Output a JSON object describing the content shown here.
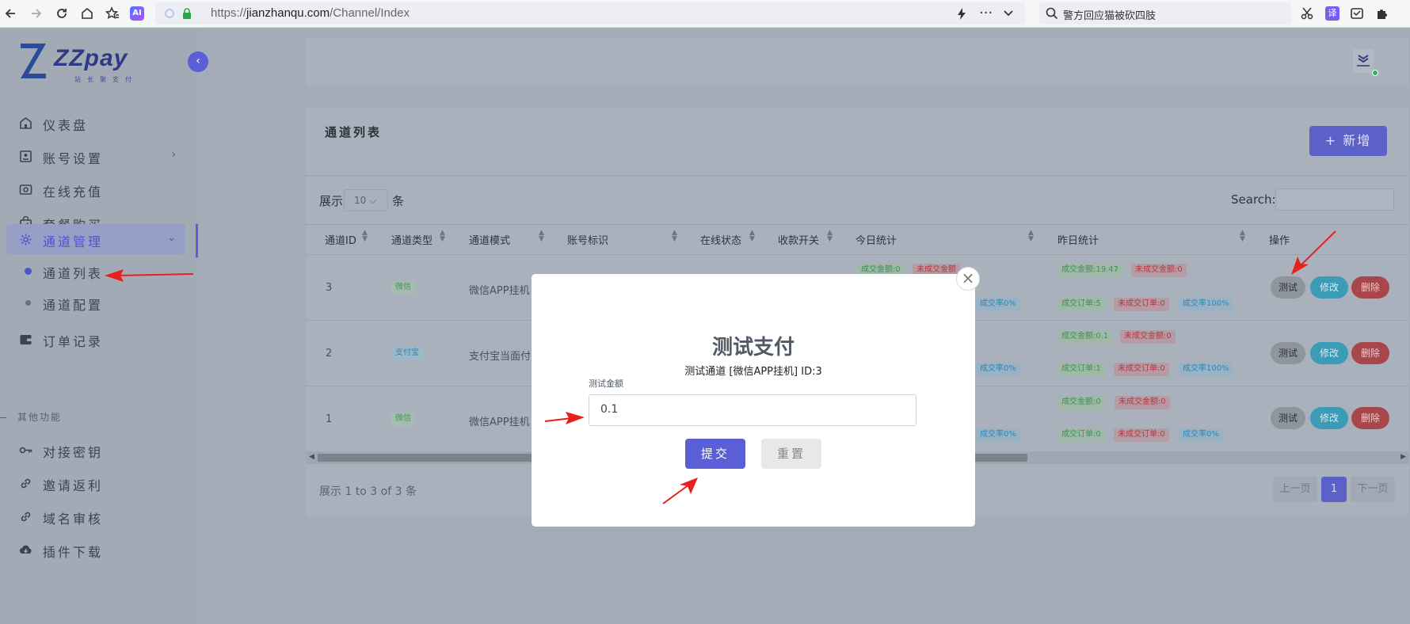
{
  "browser": {
    "url_prefix": "https://",
    "url_host": "jianzhanqu.com",
    "url_path": "/Channel/Index",
    "search_query": "警方回应猫被砍四肢",
    "ai_badge": "AI"
  },
  "sidebar": {
    "logo_word": "ZZpay",
    "logo_sub": "站长聚支付",
    "items": [
      {
        "label": "仪表盘",
        "icon": "home-icon"
      },
      {
        "label": "账号设置",
        "icon": "id-card-icon"
      },
      {
        "label": "在线充值",
        "icon": "camera-icon"
      },
      {
        "label": "套餐购买",
        "icon": "bag-icon"
      },
      {
        "label": "通道管理",
        "icon": "gear-icon"
      }
    ],
    "subitems": [
      {
        "label": "通道列表"
      },
      {
        "label": "通道配置"
      }
    ],
    "order_item": {
      "label": "订单记录",
      "icon": "wallet-icon"
    },
    "section_label": "其他功能",
    "other_items": [
      {
        "label": "对接密钥",
        "icon": "key-icon"
      },
      {
        "label": "邀请返利",
        "icon": "link-icon"
      },
      {
        "label": "域名审核",
        "icon": "link-icon"
      },
      {
        "label": "插件下载",
        "icon": "cloud-download-icon"
      }
    ]
  },
  "card": {
    "title": "通道列表",
    "add_label": "+ 新增",
    "length_prefix": "展示",
    "length_value": "10",
    "length_suffix": "条",
    "search_label": "Search:",
    "info": "展示 1 to 3 of 3 条",
    "pagination": {
      "prev": "上一页",
      "current": "1",
      "next": "下一页"
    }
  },
  "table": {
    "headers": [
      "通道ID",
      "通道类型",
      "通道模式",
      "账号标识",
      "在线状态",
      "收款开关",
      "今日统计",
      "昨日统计",
      "操作"
    ],
    "rows": [
      {
        "id": "3",
        "type": "微信",
        "mode": "微信APP挂机",
        "today": {
          "success_amount": "成交金额:0",
          "fail_amount": "未成交金额",
          "rate": "成交率0%"
        },
        "yesterday": {
          "success_amount": "成交金额:19.47",
          "fail_amount": "未成交金额:0",
          "success_orders": "成交订单:5",
          "fail_orders": "未成交订单:0",
          "rate": "成交率100%"
        }
      },
      {
        "id": "2",
        "type": "支付宝",
        "mode": "支付宝当面付",
        "today": {
          "rate": "成交率0%"
        },
        "yesterday": {
          "success_amount": "成交金额:0.1",
          "fail_amount": "未成交金额:0",
          "success_orders": "成交订单:1",
          "fail_orders": "未成交订单:0",
          "rate": "成交率100%"
        }
      },
      {
        "id": "1",
        "type": "微信",
        "mode": "微信APP挂机",
        "today": {
          "rate": "成交率0%"
        },
        "yesterday": {
          "success_amount": "成交金额:0",
          "fail_amount": "未成交金额:0",
          "success_orders": "成交订单:0",
          "fail_orders": "未成交订单:0",
          "rate": "成交率0%"
        }
      }
    ],
    "actions": {
      "test": "测试",
      "edit": "修改",
      "delete": "删除"
    }
  },
  "modal": {
    "title": "测试支付",
    "subtitle": "测试通道 [微信APP挂机] ID:3",
    "amount_label": "测试金额",
    "amount_value": "0.1",
    "submit": "提交",
    "reset": "重置",
    "close": "×"
  },
  "colors": {
    "accent": "#5a5fd6",
    "annotation_arrow": "#e8201c",
    "edit_button": "#3c9bb6",
    "delete_button": "#a8464c"
  }
}
